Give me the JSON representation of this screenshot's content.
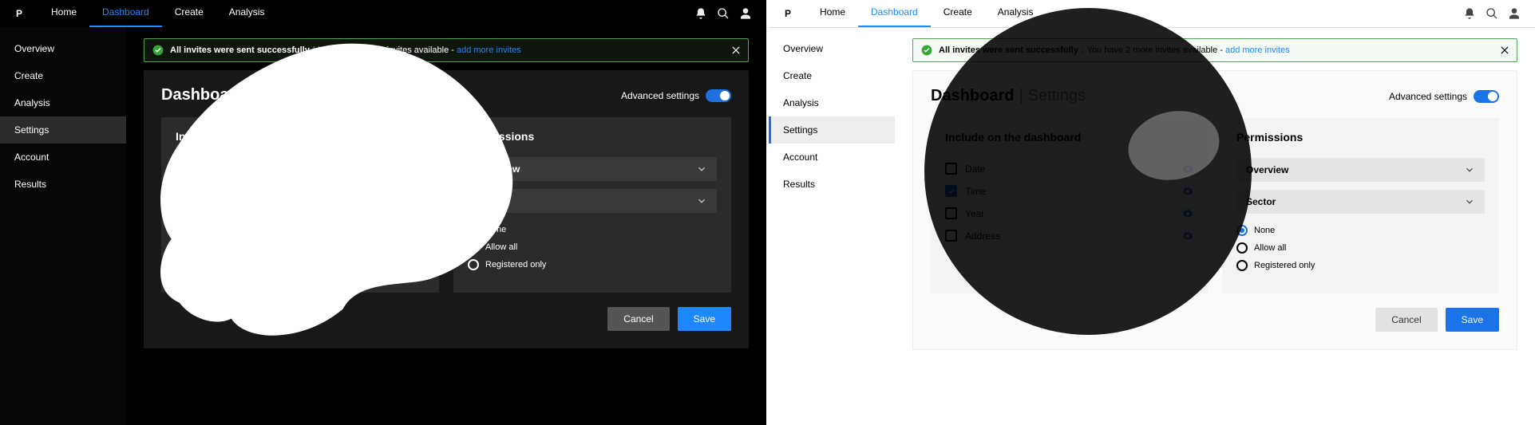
{
  "nav": {
    "logo": "P",
    "links": [
      "Home",
      "Dashboard",
      "Create",
      "Analysis"
    ],
    "active_index": 1,
    "icons": [
      "bell",
      "search",
      "user"
    ]
  },
  "sidebar": {
    "items": [
      "Overview",
      "Create",
      "Analysis",
      "Settings",
      "Account",
      "Results"
    ],
    "active_index": 3
  },
  "banner": {
    "bold": "All invites were sent successfully",
    "sep": "|",
    "rest": "You have 2 more invites available -",
    "link": "add more invites"
  },
  "page": {
    "crumb_strong": "Dashboard",
    "crumb_sep": "|",
    "crumb_section": "Settings",
    "adv_label": "Advanced settings",
    "adv_on": true
  },
  "left_panel": {
    "title": "Include on the dashboard",
    "rows": [
      "Date",
      "Time",
      "Year",
      "Address"
    ],
    "checked_index": 1
  },
  "right_panel": {
    "title": "Permissions",
    "dropdowns": [
      "Overview",
      "Sector"
    ],
    "radios": [
      "None",
      "Allow all",
      "Registered only"
    ],
    "radio_selected_index": 0
  },
  "footer": {
    "cancel": "Cancel",
    "save": "Save"
  }
}
